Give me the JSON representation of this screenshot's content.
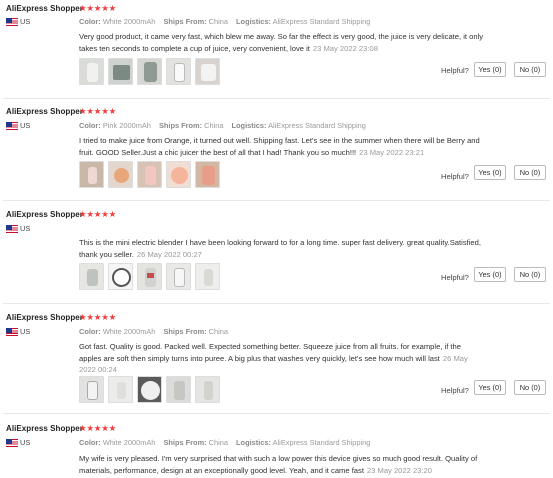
{
  "labels": {
    "color": "Color:",
    "ships_from": "Ships From:",
    "logistics": "Logistics:",
    "helpful": "Helpful?",
    "star_glyphs": "★★★★★"
  },
  "colors": {
    "stars": "#f23c3c",
    "meta": "#999999"
  },
  "reviews": [
    {
      "reviewer": "AliExpress Shopper",
      "country": "US",
      "rating": 5,
      "color": "White 2000mAh",
      "ships_from": "China",
      "logistics": "AliExpress Standard Shipping",
      "text": "Very good product, it came very fast, which blew me away. So far the effect is very good, the juice is very delicate, it only takes ten seconds to complete a cup of juice, very convenient, love it",
      "date": "23 May 2022 23:08",
      "photo_count": 5,
      "yes": "Yes (0)",
      "no": "No (0)"
    },
    {
      "reviewer": "AliExpress Shopper",
      "country": "US",
      "rating": 5,
      "color": "Pink 2000mAh",
      "ships_from": "China",
      "logistics": "AliExpress Standard Shipping",
      "text": "I tried to make juice from Orange, it turned out well. Shipping fast. Let's see in the summer when there will be Berry and fruit. GOOD Seller.Just a chic juicer the best of all that I had! Thank you so much!!!",
      "date": "23 May 2022 23:21",
      "photo_count": 5,
      "yes": "Yes (0)",
      "no": "No (0)"
    },
    {
      "reviewer": "AliExpress Shopper",
      "country": "US",
      "rating": 5,
      "color": "",
      "ships_from": "",
      "logistics": "",
      "text": "This is the mini electric blender I have been looking forward to for a long time. super fast delivery. great quality.Satisfied, thank you seller.",
      "date": "26 May 2022 00:27",
      "photo_count": 5,
      "yes": "Yes (0)",
      "no": "No (0)"
    },
    {
      "reviewer": "AliExpress Shopper",
      "country": "US",
      "rating": 5,
      "color": "White 2000mAh",
      "ships_from": "China",
      "logistics": "",
      "text": "Got fast. Quality is good. Packed well. Expected something better. Squeeze juice from all fruits. for example, if the apples are soft then simply turns into puree. A big plus that washes very quickly, let's see how much will last",
      "date": "26 May 2022 00:24",
      "photo_count": 5,
      "yes": "Yes (0)",
      "no": "No (0)"
    },
    {
      "reviewer": "AliExpress Shopper",
      "country": "US",
      "rating": 5,
      "color": "White 2000mAh",
      "ships_from": "China",
      "logistics": "AliExpress Standard Shipping",
      "text": "My wife is very pleased. I'm very surprised that with such a low power this device gives so much good result. Quality of materials, performance, design at an exceptionally good level. Yeah, and it came fast",
      "date": "23 May 2022 23:20",
      "photo_count": 0,
      "yes": "",
      "no": ""
    }
  ]
}
